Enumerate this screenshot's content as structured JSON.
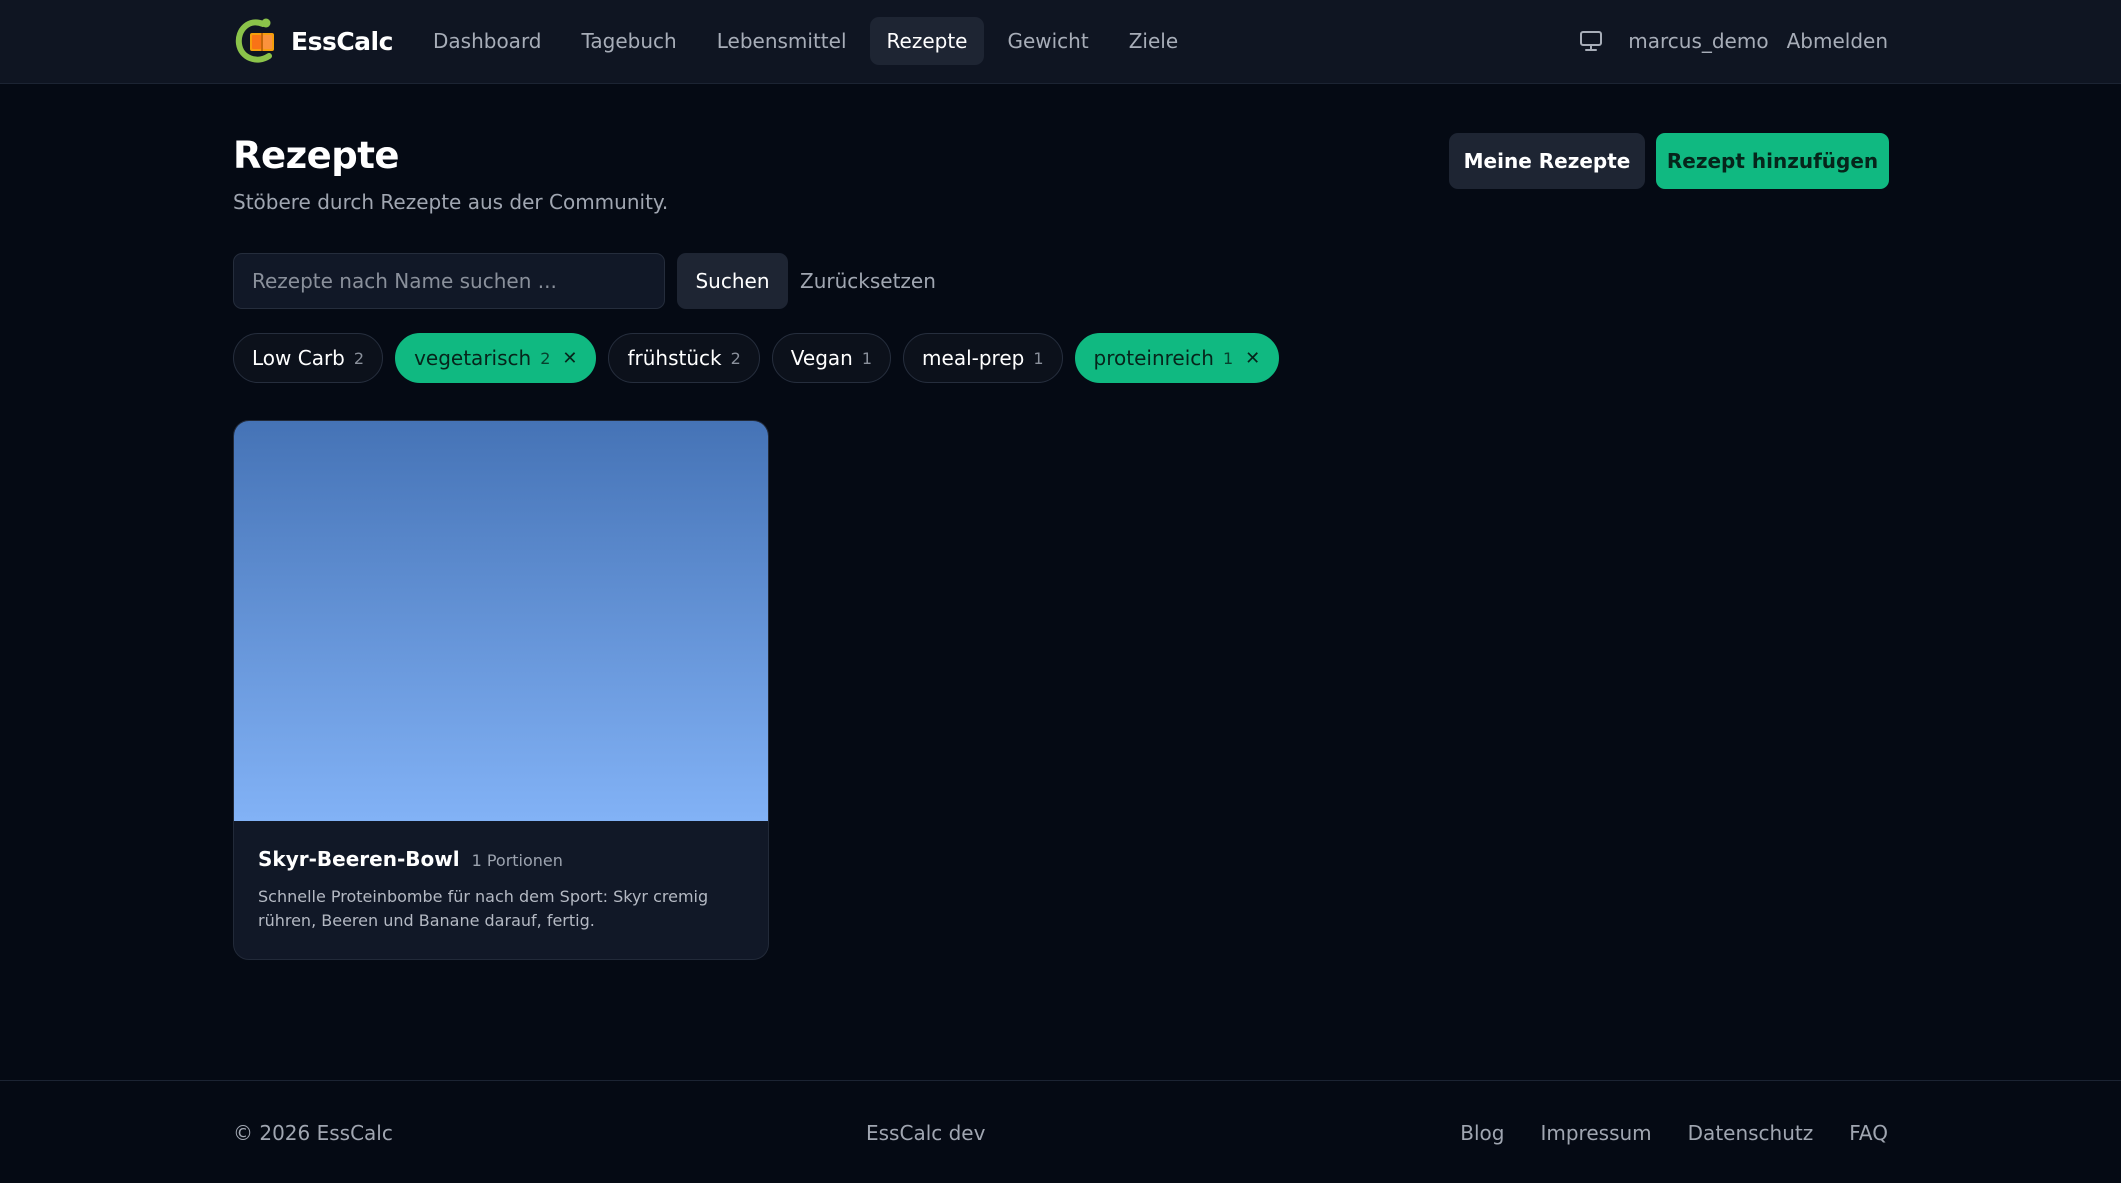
{
  "header": {
    "brand": "EssCalc",
    "nav": [
      {
        "label": "Dashboard",
        "active": false
      },
      {
        "label": "Tagebuch",
        "active": false
      },
      {
        "label": "Lebensmittel",
        "active": false
      },
      {
        "label": "Rezepte",
        "active": true
      },
      {
        "label": "Gewicht",
        "active": false
      },
      {
        "label": "Ziele",
        "active": false
      }
    ],
    "icons": {
      "display": "monitor-icon"
    },
    "username": "marcus_demo",
    "logout": "Abmelden"
  },
  "page": {
    "title": "Rezepte",
    "subtitle": "Stöbere durch Rezepte aus der Community.",
    "my_recipes": "Meine Rezepte",
    "add_recipe": "Rezept hinzufügen"
  },
  "search": {
    "placeholder": "Rezepte nach Name suchen ...",
    "value": "",
    "submit": "Suchen",
    "reset": "Zurücksetzen"
  },
  "tags": [
    {
      "label": "Low Carb",
      "count": "2",
      "selected": false
    },
    {
      "label": "vegetarisch",
      "count": "2",
      "selected": true
    },
    {
      "label": "frühstück",
      "count": "2",
      "selected": false
    },
    {
      "label": "Vegan",
      "count": "1",
      "selected": false
    },
    {
      "label": "meal-prep",
      "count": "1",
      "selected": false
    },
    {
      "label": "proteinreich",
      "count": "1",
      "selected": true
    }
  ],
  "recipes": [
    {
      "title": "Skyr-Beeren-Bowl",
      "portions": "1 Portionen",
      "description": "Schnelle Proteinbombe für nach dem Sport: Skyr cremig rühren, Beeren und Banane darauf, fertig."
    }
  ],
  "footer": {
    "copyright": "© 2026 EssCalc",
    "center": "EssCalc dev",
    "links": [
      "Blog",
      "Impressum",
      "Datenschutz",
      "FAQ"
    ]
  },
  "colors": {
    "accent": "#10b981",
    "background": "#050a14",
    "surface": "#111827"
  }
}
